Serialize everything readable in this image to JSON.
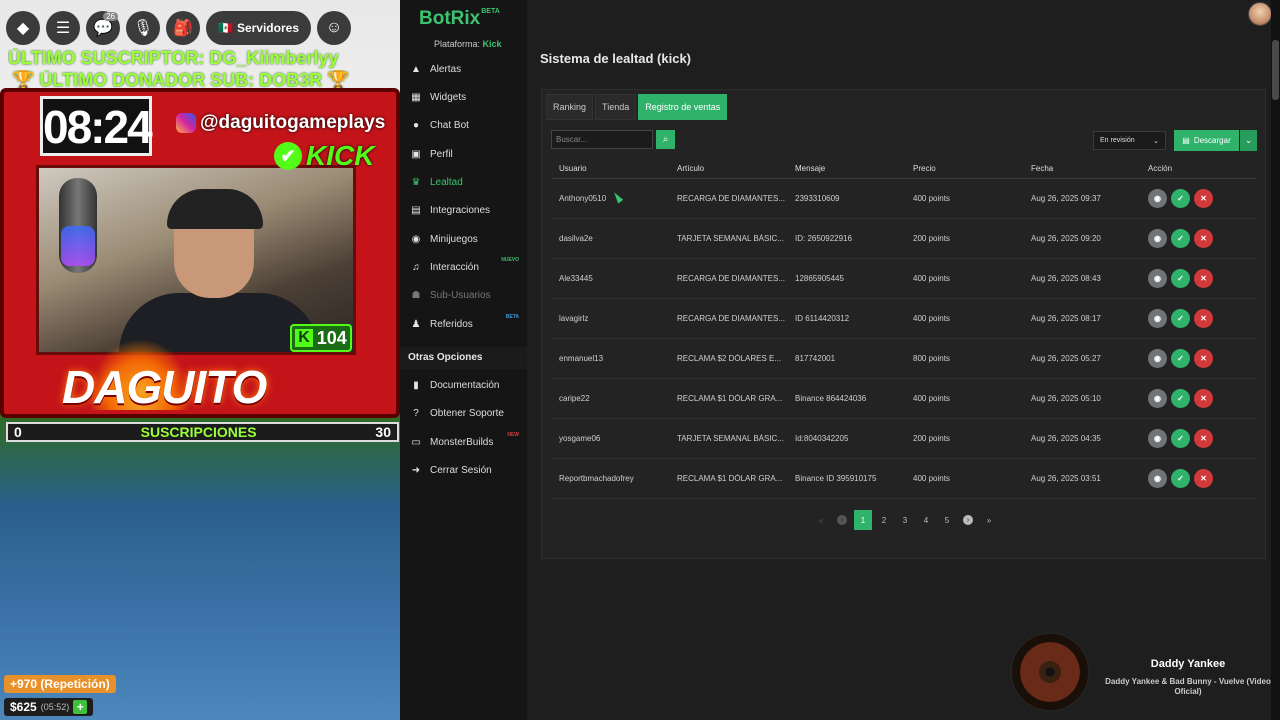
{
  "stream": {
    "topbar": {
      "servers_label": "Servidores",
      "chat_badge": "26"
    },
    "ticker_subscriber": "ÚLTIMO SUSCRIPTOR: DG_Kiimberlyy",
    "ticker_donor": "ÚLTIMO DONADOR SUB: DOB3R",
    "clock": "08:24",
    "instagram_handle": "@daguitogameplays",
    "kick_text": "KICK",
    "kick_count": "104",
    "streamer_name": "DAGUITO",
    "subs_bar": {
      "min": "0",
      "label": "SUSCRIPCIONES",
      "max": "30"
    },
    "donation": "+970 (Repetición)",
    "money": "$625",
    "money_time": "(05:52)",
    "icons": {
      "roblox": "roblox-logo-icon",
      "menu": "hamburger-icon",
      "chat": "chat-icon",
      "mic": "microphone-icon",
      "backpack": "backpack-icon",
      "flag": "mexico-flag-icon",
      "emote": "emote-icon"
    }
  },
  "app": {
    "brand": "BotRix",
    "brand_tag": "BETA",
    "platform_label": "Plataforma:",
    "platform_value": "Kick",
    "nav": [
      {
        "label": "Alertas",
        "icon": "warning-icon"
      },
      {
        "label": "Widgets",
        "icon": "widgets-icon"
      },
      {
        "label": "Chat Bot",
        "icon": "bot-icon"
      },
      {
        "label": "Perfil",
        "icon": "profile-icon"
      },
      {
        "label": "Lealtad",
        "icon": "trophy-icon"
      },
      {
        "label": "Integraciones",
        "icon": "integrations-icon"
      },
      {
        "label": "Minijuegos",
        "icon": "gamepad-icon"
      },
      {
        "label": "Interacción",
        "icon": "music-icon",
        "tag": "NUEVO"
      },
      {
        "label": "Sub-Usuarios",
        "icon": "users-icon"
      },
      {
        "label": "Referidos",
        "icon": "referral-icon",
        "tag": "BETA"
      }
    ],
    "other_heading": "Otras Opciones",
    "other": [
      {
        "label": "Documentación",
        "icon": "document-icon"
      },
      {
        "label": "Obtener Soporte",
        "icon": "help-icon"
      },
      {
        "label": "MonsterBuilds",
        "icon": "monitor-icon",
        "tag": "NEW"
      },
      {
        "label": "Cerrar Sesión",
        "icon": "logout-icon"
      }
    ],
    "page_title": "Sistema de lealtad (kick)",
    "tabs": [
      "Ranking",
      "Tienda",
      "Registro de ventas"
    ],
    "search_placeholder": "Buscar...",
    "status_filter": "En revisión",
    "download_label": "Descargar",
    "columns": [
      "Usuario",
      "Artículo",
      "Mensaje",
      "Precio",
      "Fecha",
      "Acción"
    ],
    "rows": [
      {
        "user": "Anthony0510",
        "item": "RECARGA DE DIAMANTES...",
        "msg": "2393310609",
        "price": "400 points",
        "date": "Aug 26, 2025 09:37"
      },
      {
        "user": "dasilva2e",
        "item": "TARJETA SEMANAL BÁSIC...",
        "msg": "ID: 2650922916",
        "price": "200 points",
        "date": "Aug 26, 2025 09:20"
      },
      {
        "user": "Ale33445",
        "item": "RECARGA DE DIAMANTES...",
        "msg": "12865905445",
        "price": "400 points",
        "date": "Aug 26, 2025 08:43"
      },
      {
        "user": "lavagirlz",
        "item": "RECARGA DE DIAMANTES...",
        "msg": "ID 6114420312",
        "price": "400 points",
        "date": "Aug 26, 2025 08:17"
      },
      {
        "user": "enmanuel13",
        "item": "RECLAMA $2 DÓLARES E...",
        "msg": "817742001",
        "price": "800 points",
        "date": "Aug 26, 2025 05:27"
      },
      {
        "user": "caripe22",
        "item": "RECLAMA $1 DÓLAR GRA...",
        "msg": "Binance 864424036",
        "price": "400 points",
        "date": "Aug 26, 2025 05:10"
      },
      {
        "user": "yosgame06",
        "item": "TARJETA SEMANAL BÁSIC...",
        "msg": "Id:8040342205",
        "price": "200 points",
        "date": "Aug 26, 2025 04:35"
      },
      {
        "user": "Reportbmachadofrey",
        "item": "RECLAMA $1 DÓLAR GRA...",
        "msg": "Binance ID 395910175",
        "price": "400 points",
        "date": "Aug 26, 2025 03:51"
      }
    ],
    "pages": [
      "1",
      "2",
      "3",
      "4",
      "5"
    ],
    "current_page": "1",
    "pager_icons": {
      "first": "double-chevron-left-icon",
      "prev": "chevron-left-icon",
      "next": "chevron-right-icon",
      "last": "double-chevron-right-icon"
    },
    "accent_color": "#2fb36b"
  },
  "now_playing": {
    "artist": "Daddy Yankee",
    "track": "Daddy Yankee & Bad Bunny - Vuelve (Video Oficial)"
  }
}
